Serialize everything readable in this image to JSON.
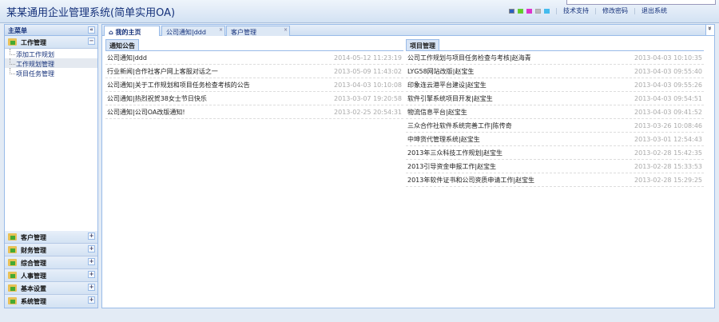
{
  "app_title": "某某通用企业管理系统(简单实用OA)",
  "theme_colors": [
    "#2a5fc0",
    "#66cc22",
    "#dd33cc",
    "#bbbbbb",
    "#44bbee"
  ],
  "top_links": [
    "技术支持",
    "修改密码",
    "退出系统"
  ],
  "sidebar": {
    "title": "主菜单",
    "collapse_icon": "«",
    "active_group": {
      "label": "工作管理",
      "toggle": "−",
      "items": [
        {
          "label": "添加工作规划"
        },
        {
          "label": "工作规划管理"
        },
        {
          "label": "项目任务管理"
        }
      ]
    },
    "groups": [
      {
        "label": "客户管理"
      },
      {
        "label": "财务管理"
      },
      {
        "label": "综合管理"
      },
      {
        "label": "人事管理"
      },
      {
        "label": "基本设置"
      },
      {
        "label": "系统管理"
      }
    ],
    "expand": "+"
  },
  "tabs": [
    {
      "label": "我的主页"
    },
    {
      "label": "公司通知|ddd"
    },
    {
      "label": "客户管理"
    }
  ],
  "tab_close": "×",
  "tab_more": "»",
  "notices": {
    "title": "通知公告",
    "rows": [
      {
        "text": "公司通知|ddd",
        "date": "2014-05-12 11:23:19"
      },
      {
        "text": "行业新闻|合作社客户网上客服对话之一",
        "date": "2013-05-09 11:43:02"
      },
      {
        "text": "公司通知|关于工作规划和项目任务检查考核的公告",
        "date": "2013-04-03 10:10:08"
      },
      {
        "text": "公司通知|热烈祝贺38女士节日快乐",
        "date": "2013-03-07 19:20:58"
      },
      {
        "text": "公司通知|公司OA改版通知!",
        "date": "2013-02-25 20:54:31"
      }
    ]
  },
  "projects": {
    "title": "项目管理",
    "rows": [
      {
        "text": "公司工作规划与项目任务检查与考核|赵海青",
        "date": "2013-04-03 10:10:35"
      },
      {
        "text": "LYG58网站改版|赵宝生",
        "date": "2013-04-03 09:55:40"
      },
      {
        "text": "印象连云港平台建设|赵宝生",
        "date": "2013-04-03 09:55:26"
      },
      {
        "text": "软件引擎系统项目开发|赵宝生",
        "date": "2013-04-03 09:54:51"
      },
      {
        "text": "物流信息平台|赵宝生",
        "date": "2013-04-03 09:41:52"
      },
      {
        "text": "三众合作社软件系统完善工作|陈传奇",
        "date": "2013-03-26 10:08:46"
      },
      {
        "text": "中坤货代管理系统|赵宝生",
        "date": "2013-03-01 12:54:43"
      },
      {
        "text": "2013年三众科技工作规划|赵宝生",
        "date": "2013-02-28 15:42:35"
      },
      {
        "text": "2013引导资金申报工作|赵宝生",
        "date": "2013-02-28 15:33:53"
      },
      {
        "text": "2013年软件证书和公司资质申请工作|赵宝生",
        "date": "2013-02-28 15:29:25"
      }
    ]
  }
}
